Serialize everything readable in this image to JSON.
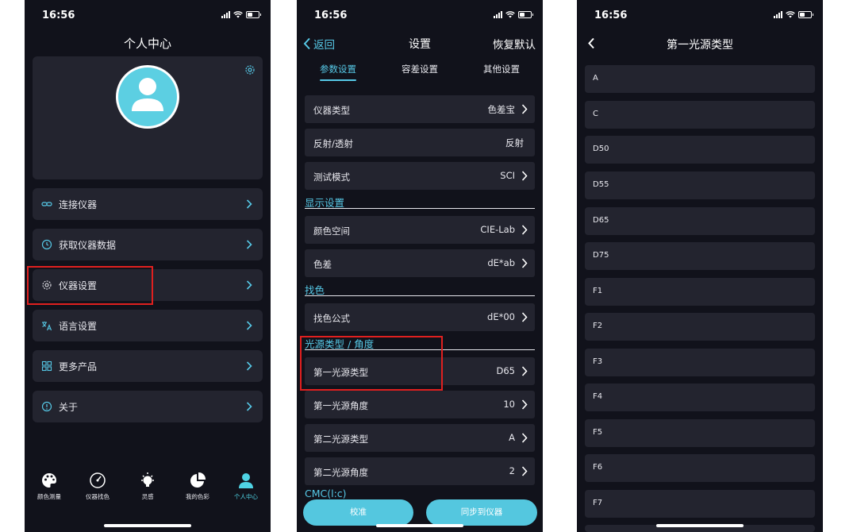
{
  "status_time": "16:56",
  "profile_screen": {
    "title": "个人中心",
    "menu": [
      {
        "label": "连接仪器",
        "icon": "link-icon"
      },
      {
        "label": "获取仪器数据",
        "icon": "clock-icon"
      },
      {
        "label": "仪器设置",
        "icon": "gear-icon"
      },
      {
        "label": "语言设置",
        "icon": "translate-icon"
      },
      {
        "label": "更多产品",
        "icon": "grid-icon"
      },
      {
        "label": "关于",
        "icon": "info-icon"
      }
    ],
    "tabbar": [
      {
        "label": "颜色测量",
        "icon": "palette-icon"
      },
      {
        "label": "仪器找色",
        "icon": "gauge-icon"
      },
      {
        "label": "灵感",
        "icon": "lightbulb-icon"
      },
      {
        "label": "我的色彩",
        "icon": "pie-chart-icon"
      },
      {
        "label": "个人中心",
        "icon": "person-icon"
      }
    ]
  },
  "settings_screen": {
    "back_label": "返回",
    "title": "设置",
    "reset_label": "恢复默认",
    "tabs": [
      "参数设置",
      "容差设置",
      "其他设置"
    ],
    "rows": [
      {
        "label": "仪器类型",
        "value": "色差宝"
      },
      {
        "label": "反射/透射",
        "value": "反射"
      },
      {
        "label": "测试模式",
        "value": "SCI"
      },
      {
        "label": "颜色空间",
        "value": "CIE-Lab"
      },
      {
        "label": "色差",
        "value": "dE*ab"
      },
      {
        "label": "找色公式",
        "value": "dE*00"
      },
      {
        "label": "第一光源类型",
        "value": "D65"
      },
      {
        "label": "第一光源角度",
        "value": "10"
      },
      {
        "label": "第二光源类型",
        "value": "A"
      },
      {
        "label": "第二光源角度",
        "value": "2"
      }
    ],
    "sections": [
      "显示设置",
      "找色",
      "光源类型 / 角度",
      "CMC(l:c)"
    ],
    "calibrate_label": "校准",
    "sync_label": "同步到仪器"
  },
  "illuminant_screen": {
    "title": "第一光源类型",
    "options": [
      "A",
      "C",
      "D50",
      "D55",
      "D65",
      "D75",
      "F1",
      "F2",
      "F3",
      "F4",
      "F5",
      "F6",
      "F7"
    ]
  },
  "colors": {
    "accent": "#56c8e6",
    "background": "#11121b",
    "card": "#23242f",
    "highlight": "#e0201f"
  }
}
